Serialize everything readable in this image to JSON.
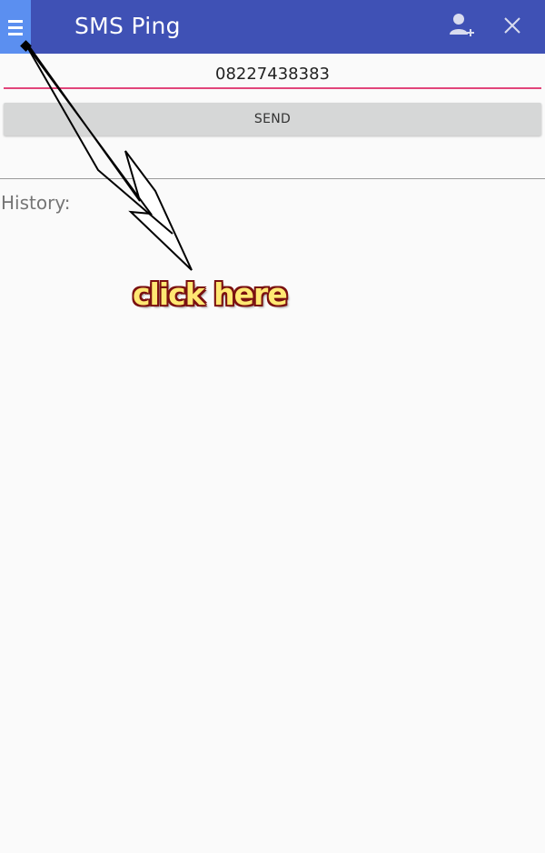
{
  "appbar": {
    "title": "SMS Ping",
    "background_color": "#3f51b5",
    "menu_icon": "hamburger-menu-icon",
    "add_contact_icon": "add-contact-icon",
    "close_icon": "close-icon"
  },
  "form": {
    "phone_number": "08227438383",
    "accent_color": "#e2457a",
    "send_label": "SEND"
  },
  "history": {
    "label": "History:",
    "items": []
  },
  "annotation": {
    "text": "click here"
  }
}
